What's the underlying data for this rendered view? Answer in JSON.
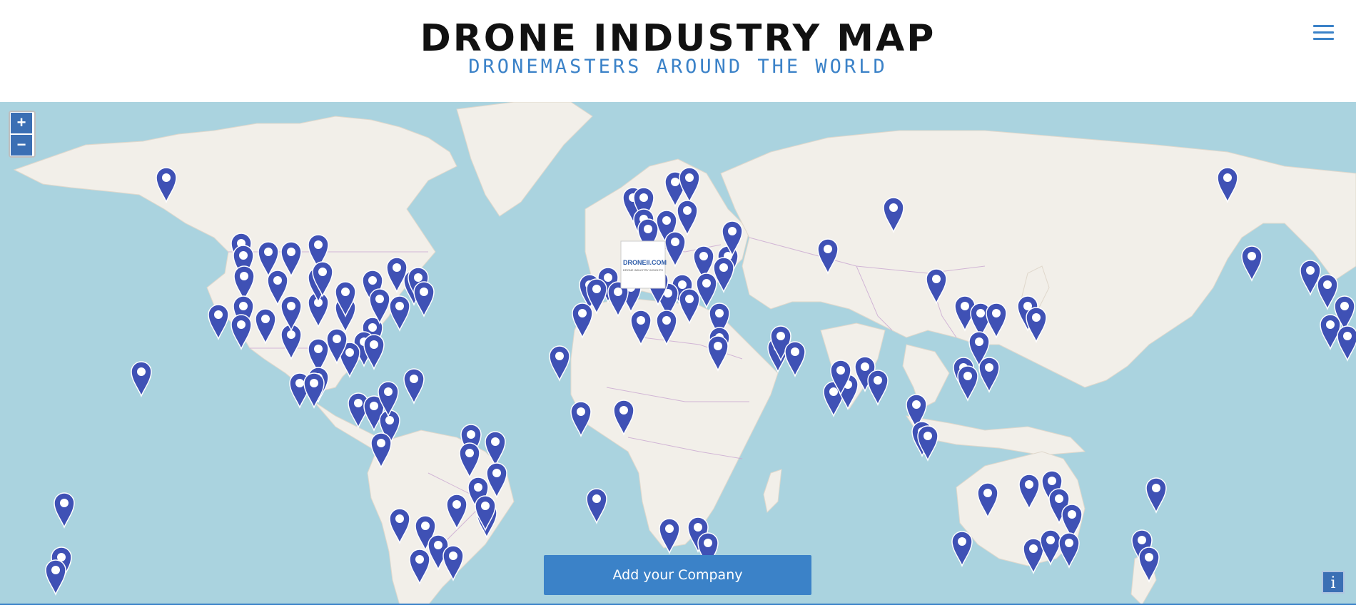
{
  "header": {
    "title": "DRONE INDUSTRY MAP",
    "subtitle": "DRONEMASTERS AROUND THE WORLD",
    "menu_icon": "hamburger-menu-icon"
  },
  "map": {
    "zoom_in_label": "+",
    "zoom_out_label": "−",
    "ocean_color": "#aad3df",
    "land_color": "#f2efe9",
    "border_color": "#c9a7d1",
    "marker_color": "#3f51b5",
    "popup_logo_text": "DRONEII.COM",
    "popup_logo_subtext": "DRONE INDUSTRY INSIGHTS"
  },
  "add_company_label": "Add your Company",
  "info_label": "i"
}
